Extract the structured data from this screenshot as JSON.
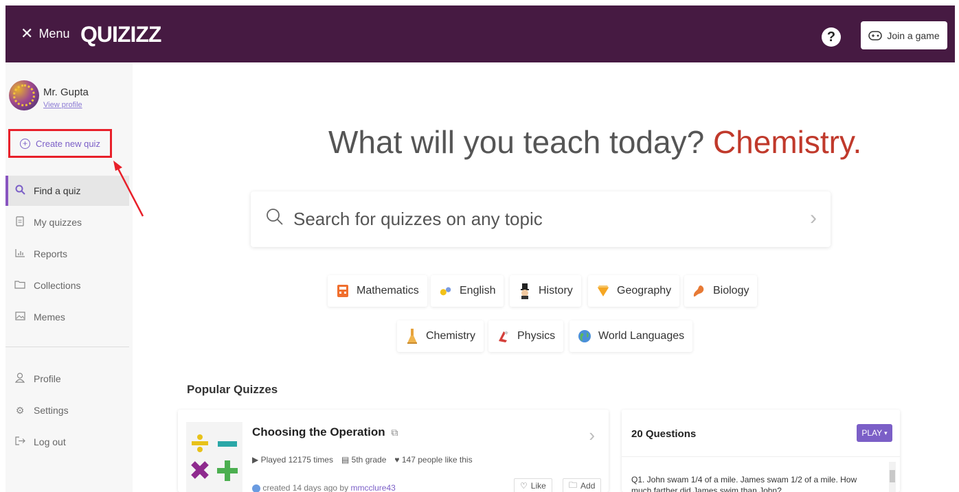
{
  "header": {
    "menu_x": "✕",
    "menu_label": "Menu",
    "logo": "QUIZIZZ",
    "help": "?",
    "join_label": "Join a game"
  },
  "sidebar": {
    "user_name": "Mr. Gupta",
    "view_profile": "View profile",
    "create_quiz": "Create new quiz",
    "nav": [
      {
        "label": "Find a quiz",
        "icon": "search-icon",
        "active": true
      },
      {
        "label": "My quizzes",
        "icon": "document-icon",
        "active": false
      },
      {
        "label": "Reports",
        "icon": "bar-chart-icon",
        "active": false
      },
      {
        "label": "Collections",
        "icon": "folder-icon",
        "active": false
      },
      {
        "label": "Memes",
        "icon": "image-icon",
        "active": false
      }
    ],
    "secondary": [
      {
        "label": "Profile",
        "icon": "user-icon"
      },
      {
        "label": "Settings",
        "icon": "gear-icon"
      },
      {
        "label": "Log out",
        "icon": "logout-icon"
      }
    ]
  },
  "hero": {
    "prefix": "What will you teach today?",
    "subject": "Chemistry."
  },
  "search": {
    "placeholder": "Search for quizzes on any topic"
  },
  "subjects": [
    {
      "label": "Mathematics",
      "icon": "calculator-icon"
    },
    {
      "label": "English",
      "icon": "english-icon"
    },
    {
      "label": "History",
      "icon": "history-icon"
    },
    {
      "label": "Geography",
      "icon": "geography-icon"
    },
    {
      "label": "Biology",
      "icon": "biology-icon"
    },
    {
      "label": "Chemistry",
      "icon": "chemistry-icon"
    },
    {
      "label": "Physics",
      "icon": "magnet-icon"
    },
    {
      "label": "World Languages",
      "icon": "globe-icon"
    }
  ],
  "popular": {
    "title": "Popular Quizzes",
    "quiz": {
      "title": "Choosing the Operation",
      "played": "Played 12175 times",
      "grade": "5th grade",
      "likes": "147 people like this",
      "created_prefix": "created 14 days ago by",
      "creator": "mmcclure43",
      "like_label": "Like",
      "add_label": "Add"
    },
    "preview": {
      "questions": "20 Questions",
      "play_label": "PLAY",
      "q1": "Q1. John swam 1/4 of a mile. James swam 1/2 of a mile. How much farther did James swim than John?"
    }
  },
  "colors": {
    "header_bg": "#461a42",
    "accent": "#7b5fc7",
    "highlight_border": "#e8202a",
    "hero_subject": "#c0392b"
  }
}
